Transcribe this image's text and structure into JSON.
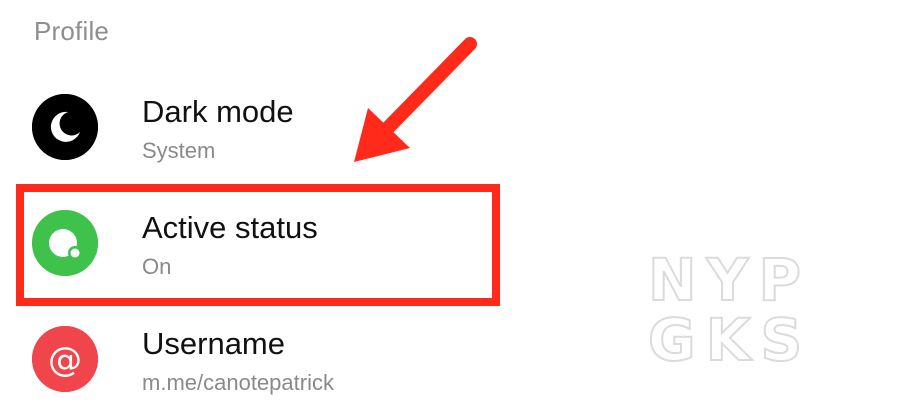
{
  "section": {
    "title": "Profile"
  },
  "items": [
    {
      "title": "Dark mode",
      "subtitle": "System",
      "icon": "moon-icon",
      "color": "#000000"
    },
    {
      "title": "Active status",
      "subtitle": "On",
      "icon": "active-status-icon",
      "color": "#3FC24B"
    },
    {
      "title": "Username",
      "subtitle": "m.me/canotepatrick",
      "icon": "at-icon",
      "color": "#F0454A"
    }
  ],
  "annotation": {
    "highlight_color": "#FF2A1A"
  },
  "watermark": {
    "line1": "NYP",
    "line2": "GKS"
  }
}
